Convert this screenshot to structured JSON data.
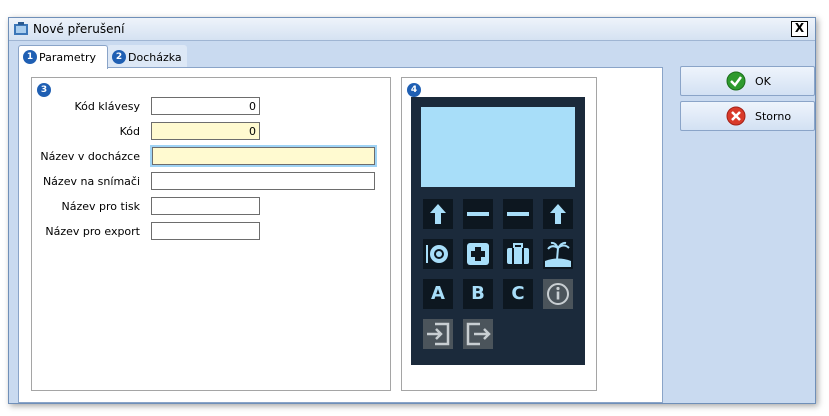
{
  "window": {
    "title": "Nové přerušení",
    "close_label": "X"
  },
  "tabs": [
    {
      "num": "1",
      "label": "Parametry",
      "active": true
    },
    {
      "num": "2",
      "label": "Docházka",
      "active": false
    }
  ],
  "group_left_badge": "3",
  "group_right_badge": "4",
  "form": {
    "kod_klavesy": {
      "label": "Kód klávesy",
      "value": "0"
    },
    "kod": {
      "label": "Kód",
      "value": "0"
    },
    "nazev_dochazka": {
      "label": "Název v docházce",
      "value": ""
    },
    "nazev_snimac": {
      "label": "Název na snímači",
      "value": ""
    },
    "nazev_tisk": {
      "label": "Název pro tisk",
      "value": ""
    },
    "nazev_export": {
      "label": "Název pro export",
      "value": ""
    }
  },
  "keypad": {
    "screen_color": "#a8def9",
    "body_color": "#1b2a3b",
    "keys": [
      "arrow-up-icon",
      "dash-icon",
      "dash-icon",
      "arrow-up-icon",
      "plate-icon",
      "medical-cross-icon",
      "suitcase-icon",
      "island-icon",
      "A",
      "B",
      "C",
      "info-icon",
      "login-icon",
      "logout-icon"
    ]
  },
  "buttons": {
    "ok": "OK",
    "cancel": "Storno"
  }
}
